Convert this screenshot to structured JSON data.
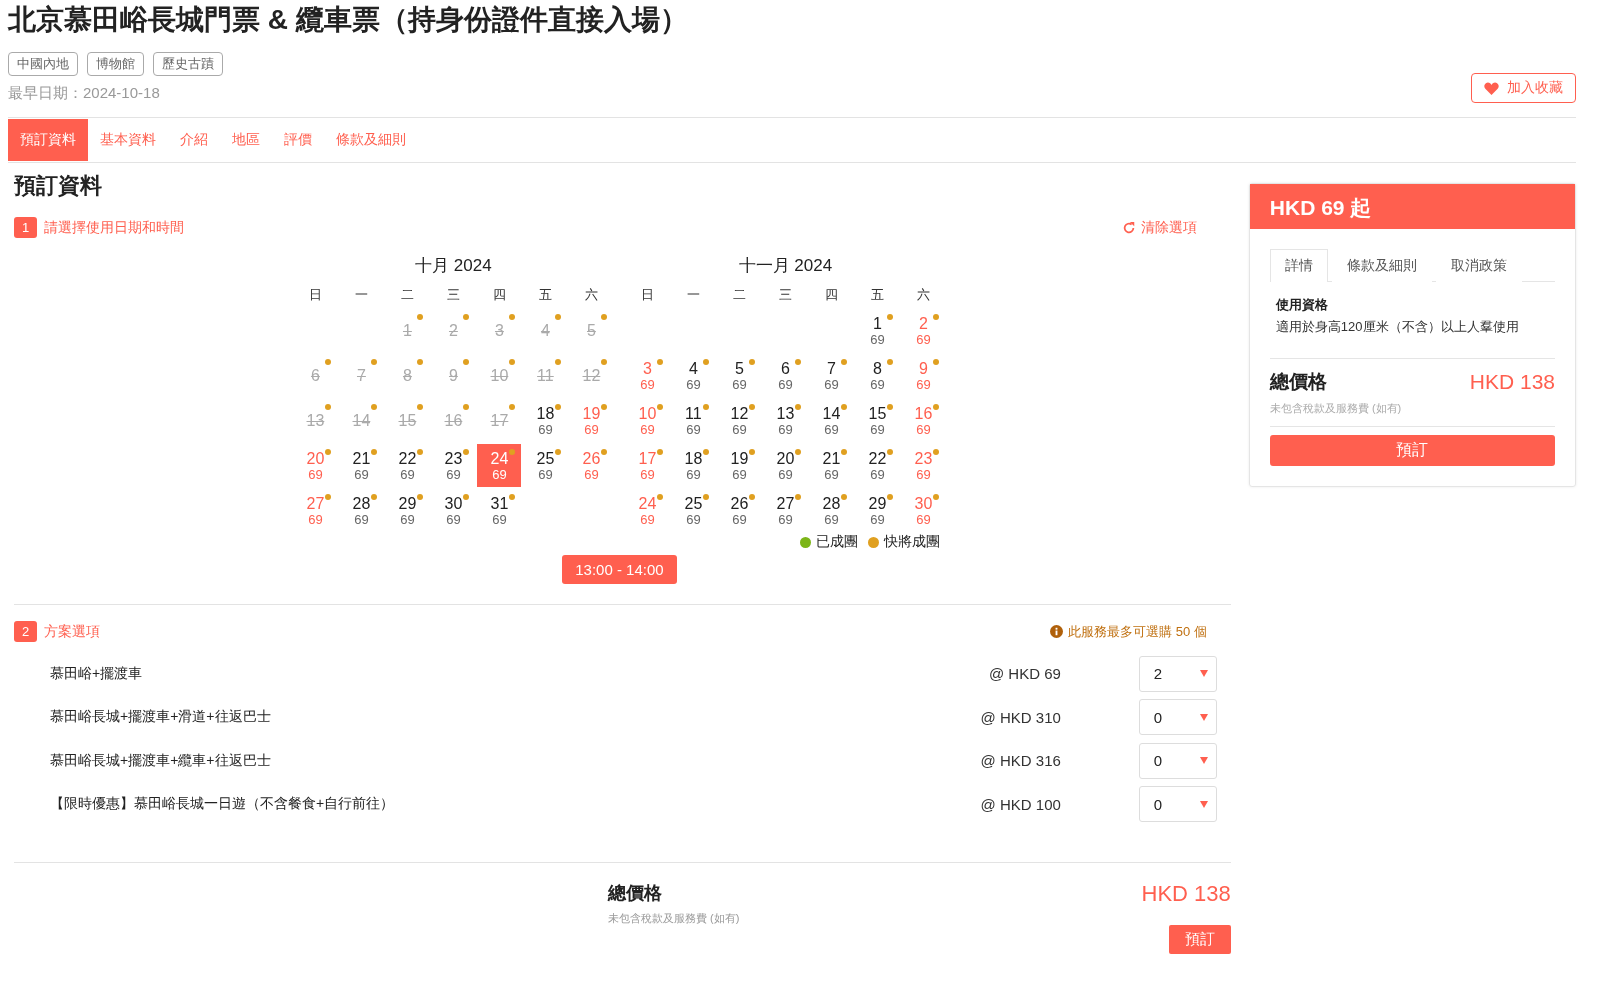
{
  "product": {
    "title": "北京慕田峪長城門票 & 纜車票（持身份證件直接入場）",
    "tags": [
      "中國內地",
      "博物館",
      "歷史古蹟"
    ],
    "earliest_date": "最早日期：2024-10-18",
    "favorite_button": "加入收藏"
  },
  "tabs": [
    {
      "label": "預訂資料",
      "selected": true
    },
    {
      "label": "基本資料",
      "selected": false
    },
    {
      "label": "介紹",
      "selected": false
    },
    {
      "label": "地區",
      "selected": false
    },
    {
      "label": "評價",
      "selected": false
    },
    {
      "label": "條款及細則",
      "selected": false
    }
  ],
  "section_title": "預訂資料",
  "step1": {
    "number": "1",
    "label": "請選擇使用日期和時間",
    "clear_button": "清除選項"
  },
  "calendar": {
    "legend": [
      {
        "label": "已成團",
        "color": "#7cb518"
      },
      {
        "label": "快將成團",
        "color": "#e0a020"
      }
    ],
    "months": [
      {
        "title": "十月 2024",
        "weekdays": [
          "日",
          "一",
          "二",
          "三",
          "四",
          "五",
          "六"
        ],
        "days": [
          {
            "kind": "blank"
          },
          {
            "kind": "blank"
          },
          {
            "kind": "day",
            "day": "1",
            "disabled": true,
            "selected": false,
            "color": "#e0a020"
          },
          {
            "kind": "day",
            "day": "2",
            "disabled": true,
            "selected": false,
            "color": "#e0a020"
          },
          {
            "kind": "day",
            "day": "3",
            "disabled": true,
            "selected": false,
            "color": "#e0a020"
          },
          {
            "kind": "day",
            "day": "4",
            "disabled": true,
            "selected": false,
            "color": "#e0a020"
          },
          {
            "kind": "day",
            "day": "5",
            "disabled": true,
            "selected": false,
            "color": "#e0a020"
          },
          {
            "kind": "day",
            "day": "6",
            "disabled": true,
            "selected": false,
            "color": "#e0a020"
          },
          {
            "kind": "day",
            "day": "7",
            "disabled": true,
            "selected": false,
            "color": "#e0a020"
          },
          {
            "kind": "day",
            "day": "8",
            "disabled": true,
            "selected": false,
            "color": "#e0a020"
          },
          {
            "kind": "day",
            "day": "9",
            "disabled": true,
            "selected": false,
            "color": "#e0a020"
          },
          {
            "kind": "day",
            "day": "10",
            "disabled": true,
            "selected": false,
            "color": "#e0a020"
          },
          {
            "kind": "day",
            "day": "11",
            "disabled": true,
            "selected": false,
            "color": "#e0a020"
          },
          {
            "kind": "day",
            "day": "12",
            "disabled": true,
            "selected": false,
            "color": "#e0a020"
          },
          {
            "kind": "day",
            "day": "13",
            "disabled": true,
            "selected": false,
            "color": "#e0a020"
          },
          {
            "kind": "day",
            "day": "14",
            "disabled": true,
            "selected": false,
            "color": "#e0a020"
          },
          {
            "kind": "day",
            "day": "15",
            "disabled": true,
            "selected": false,
            "color": "#e0a020"
          },
          {
            "kind": "day",
            "day": "16",
            "disabled": true,
            "selected": false,
            "color": "#e0a020"
          },
          {
            "kind": "day",
            "day": "17",
            "disabled": true,
            "selected": false,
            "color": "#e0a020"
          },
          {
            "kind": "day",
            "day": "18",
            "price": "69",
            "disabled": false,
            "selected": false,
            "color": "#e0a020"
          },
          {
            "kind": "day",
            "day": "19",
            "price": "69",
            "disabled": false,
            "selected": false,
            "color": "#e0a020"
          },
          {
            "kind": "day",
            "day": "20",
            "price": "69",
            "disabled": false,
            "selected": false,
            "color": "#e0a020"
          },
          {
            "kind": "day",
            "day": "21",
            "price": "69",
            "disabled": false,
            "selected": false,
            "color": "#e0a020"
          },
          {
            "kind": "day",
            "day": "22",
            "price": "69",
            "disabled": false,
            "selected": false,
            "color": "#e0a020"
          },
          {
            "kind": "day",
            "day": "23",
            "price": "69",
            "disabled": false,
            "selected": false,
            "color": "#e0a020"
          },
          {
            "kind": "day",
            "day": "24",
            "price": "69",
            "disabled": false,
            "selected": true,
            "color": "#e0a020"
          },
          {
            "kind": "day",
            "day": "25",
            "price": "69",
            "disabled": false,
            "selected": false,
            "color": "#e0a020"
          },
          {
            "kind": "day",
            "day": "26",
            "price": "69",
            "disabled": false,
            "selected": false,
            "color": "#e0a020"
          },
          {
            "kind": "day",
            "day": "27",
            "price": "69",
            "disabled": false,
            "selected": false,
            "color": "#e0a020"
          },
          {
            "kind": "day",
            "day": "28",
            "price": "69",
            "disabled": false,
            "selected": false,
            "color": "#e0a020"
          },
          {
            "kind": "day",
            "day": "29",
            "price": "69",
            "disabled": false,
            "selected": false,
            "color": "#e0a020"
          },
          {
            "kind": "day",
            "day": "30",
            "price": "69",
            "disabled": false,
            "selected": false,
            "color": "#e0a020"
          },
          {
            "kind": "day",
            "day": "31",
            "price": "69",
            "disabled": false,
            "selected": false,
            "color": "#e0a020"
          }
        ]
      },
      {
        "title": "十一月 2024",
        "weekdays": [
          "日",
          "一",
          "二",
          "三",
          "四",
          "五",
          "六"
        ],
        "days": [
          {
            "kind": "blank"
          },
          {
            "kind": "blank"
          },
          {
            "kind": "blank"
          },
          {
            "kind": "blank"
          },
          {
            "kind": "blank"
          },
          {
            "kind": "day",
            "day": "1",
            "price": "69",
            "disabled": false,
            "selected": false,
            "color": "#e0a020"
          },
          {
            "kind": "day",
            "day": "2",
            "price": "69",
            "disabled": false,
            "selected": false,
            "color": "#e0a020"
          },
          {
            "kind": "day",
            "day": "3",
            "price": "69",
            "disabled": false,
            "selected": false,
            "color": "#e0a020"
          },
          {
            "kind": "day",
            "day": "4",
            "price": "69",
            "disabled": false,
            "selected": false,
            "color": "#e0a020"
          },
          {
            "kind": "day",
            "day": "5",
            "price": "69",
            "disabled": false,
            "selected": false,
            "color": "#e0a020"
          },
          {
            "kind": "day",
            "day": "6",
            "price": "69",
            "disabled": false,
            "selected": false,
            "color": "#e0a020"
          },
          {
            "kind": "day",
            "day": "7",
            "price": "69",
            "disabled": false,
            "selected": false,
            "color": "#e0a020"
          },
          {
            "kind": "day",
            "day": "8",
            "price": "69",
            "disabled": false,
            "selected": false,
            "color": "#e0a020"
          },
          {
            "kind": "day",
            "day": "9",
            "price": "69",
            "disabled": false,
            "selected": false,
            "color": "#e0a020"
          },
          {
            "kind": "day",
            "day": "10",
            "price": "69",
            "disabled": false,
            "selected": false,
            "color": "#e0a020"
          },
          {
            "kind": "day",
            "day": "11",
            "price": "69",
            "disabled": false,
            "selected": false,
            "color": "#e0a020"
          },
          {
            "kind": "day",
            "day": "12",
            "price": "69",
            "disabled": false,
            "selected": false,
            "color": "#e0a020"
          },
          {
            "kind": "day",
            "day": "13",
            "price": "69",
            "disabled": false,
            "selected": false,
            "color": "#e0a020"
          },
          {
            "kind": "day",
            "day": "14",
            "price": "69",
            "disabled": false,
            "selected": false,
            "color": "#e0a020"
          },
          {
            "kind": "day",
            "day": "15",
            "price": "69",
            "disabled": false,
            "selected": false,
            "color": "#e0a020"
          },
          {
            "kind": "day",
            "day": "16",
            "price": "69",
            "disabled": false,
            "selected": false,
            "color": "#e0a020"
          },
          {
            "kind": "day",
            "day": "17",
            "price": "69",
            "disabled": false,
            "selected": false,
            "color": "#e0a020"
          },
          {
            "kind": "day",
            "day": "18",
            "price": "69",
            "disabled": false,
            "selected": false,
            "color": "#e0a020"
          },
          {
            "kind": "day",
            "day": "19",
            "price": "69",
            "disabled": false,
            "selected": false,
            "color": "#e0a020"
          },
          {
            "kind": "day",
            "day": "20",
            "price": "69",
            "disabled": false,
            "selected": false,
            "color": "#e0a020"
          },
          {
            "kind": "day",
            "day": "21",
            "price": "69",
            "disabled": false,
            "selected": false,
            "color": "#e0a020"
          },
          {
            "kind": "day",
            "day": "22",
            "price": "69",
            "disabled": false,
            "selected": false,
            "color": "#e0a020"
          },
          {
            "kind": "day",
            "day": "23",
            "price": "69",
            "disabled": false,
            "selected": false,
            "color": "#e0a020"
          },
          {
            "kind": "day",
            "day": "24",
            "price": "69",
            "disabled": false,
            "selected": false,
            "color": "#e0a020"
          },
          {
            "kind": "day",
            "day": "25",
            "price": "69",
            "disabled": false,
            "selected": false,
            "color": "#e0a020"
          },
          {
            "kind": "day",
            "day": "26",
            "price": "69",
            "disabled": false,
            "selected": false,
            "color": "#e0a020"
          },
          {
            "kind": "day",
            "day": "27",
            "price": "69",
            "disabled": false,
            "selected": false,
            "color": "#e0a020"
          },
          {
            "kind": "day",
            "day": "28",
            "price": "69",
            "disabled": false,
            "selected": false,
            "color": "#e0a020"
          },
          {
            "kind": "day",
            "day": "29",
            "price": "69",
            "disabled": false,
            "selected": false,
            "color": "#e0a020"
          },
          {
            "kind": "day",
            "day": "30",
            "price": "69",
            "disabled": false,
            "selected": false,
            "color": "#e0a020"
          }
        ]
      }
    ],
    "time_slots": [
      {
        "label": "13:00 - 14:00",
        "selected": true
      }
    ]
  },
  "step2": {
    "number": "2",
    "label": "方案選項",
    "limit_note": "此服務最多可選購 50 個",
    "options": [
      {
        "name": "慕田峪+擺渡車",
        "price": "@ HKD 69",
        "quantity": "2"
      },
      {
        "name": "慕田峪長城+擺渡車+滑道+往返巴士",
        "price": "@ HKD 310",
        "quantity": "0"
      },
      {
        "name": "慕田峪長城+擺渡車+纜車+往返巴士",
        "price": "@ HKD 316",
        "quantity": "0"
      },
      {
        "name": "【限時優惠】慕田峪長城一日遊（不含餐食+自行前往）",
        "price": "@ HKD 100",
        "quantity": "0"
      }
    ]
  },
  "footer": {
    "total_label": "總價格",
    "note": "未包含稅款及服務費 (如有)",
    "total": "HKD 138",
    "book_button": "預訂"
  },
  "sidebar": {
    "price_header": "HKD 69 起",
    "tabs": [
      {
        "label": "詳情",
        "selected": true
      },
      {
        "label": "條款及細則",
        "selected": false
      },
      {
        "label": "取消政策",
        "selected": false
      }
    ],
    "eligibility_title": "使用資格",
    "eligibility_text": "適用於身高120厘米（不含）以上人羣使用",
    "total_label": "總價格",
    "note": "未包含稅款及服務費 (如有)",
    "total": "HKD 138",
    "book_button": "預訂"
  }
}
